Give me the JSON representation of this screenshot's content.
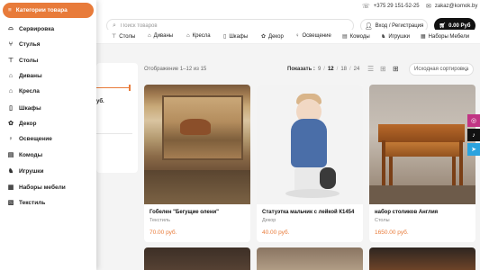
{
  "topbar": {
    "phone": "+375 29 151-52-25",
    "email": "zakaz@komok.by"
  },
  "header": {
    "search_placeholder": "Поиск товаров",
    "login_label": "Вход / Регистрация",
    "cart_total": "0.00 Руб"
  },
  "catnav": [
    {
      "label": "Столы",
      "icon": "table-icon"
    },
    {
      "label": "Диваны",
      "icon": "sofa-icon"
    },
    {
      "label": "Кресла",
      "icon": "armchair-icon"
    },
    {
      "label": "Шкафы",
      "icon": "wardrobe-icon"
    },
    {
      "label": "Декор",
      "icon": "decor-icon"
    },
    {
      "label": "Освещение",
      "icon": "lamp-icon"
    },
    {
      "label": "Комоды",
      "icon": "dresser-icon"
    },
    {
      "label": "Игрушки",
      "icon": "toy-icon"
    },
    {
      "label": "Наборы Мебели",
      "icon": "furniture-set-icon"
    }
  ],
  "drawer": {
    "title": "Категории товара",
    "items": [
      {
        "label": "Сервировка",
        "icon": "tableware-icon"
      },
      {
        "label": "Стулья",
        "icon": "chair-icon"
      },
      {
        "label": "Столы",
        "icon": "table-icon"
      },
      {
        "label": "Диваны",
        "icon": "sofa-icon"
      },
      {
        "label": "Кресла",
        "icon": "armchair-icon"
      },
      {
        "label": "Шкафы",
        "icon": "wardrobe-icon"
      },
      {
        "label": "Декор",
        "icon": "decor-icon"
      },
      {
        "label": "Освещение",
        "icon": "lamp-icon"
      },
      {
        "label": "Комоды",
        "icon": "dresser-icon"
      },
      {
        "label": "Игрушки",
        "icon": "toy-icon"
      },
      {
        "label": "Наборы мебели",
        "icon": "furniture-set-icon"
      },
      {
        "label": "Текстиль",
        "icon": "textile-icon"
      }
    ]
  },
  "filter": {
    "partial_text": "уб."
  },
  "toolbar": {
    "results_text": "Отображение 1–12 из 15",
    "show_label": "Показать :",
    "show_options": [
      "9",
      "12",
      "18",
      "24"
    ],
    "show_active": "12",
    "sort_label": "Исходная сортировка"
  },
  "products": [
    {
      "title": "Гобелен \"Бегущие олени\"",
      "category": "Текстиль",
      "price": "70.00 руб."
    },
    {
      "title": "Статуэтка мальчик с лейкой К1454",
      "category": "Декор",
      "price": "40.00 руб."
    },
    {
      "title": "набор столиков Англия",
      "category": "Столы",
      "price": "1650.00 руб."
    }
  ],
  "colors": {
    "accent": "#e87b3a",
    "cart_bg": "#111111",
    "instagram": "#c13584",
    "tiktok": "#111111",
    "telegram": "#2aa3df"
  }
}
